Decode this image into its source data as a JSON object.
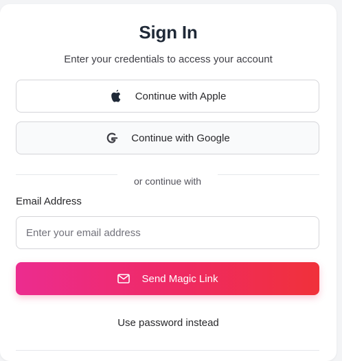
{
  "header": {
    "title": "Sign In",
    "subtitle": "Enter your credentials to access your account"
  },
  "oauth": {
    "apple_label": "Continue with Apple",
    "apple_icon": "apple-logo-icon",
    "google_label": "Continue with Google",
    "google_icon": "google-g-icon"
  },
  "divider": {
    "text": "or continue with"
  },
  "email": {
    "label": "Email Address",
    "value": "",
    "placeholder": "Enter your email address"
  },
  "magic_link": {
    "label": "Send Magic Link",
    "icon": "mail-icon",
    "gradient_start": "#ec2c8f",
    "gradient_end": "#f0313a"
  },
  "alternate": {
    "password_label": "Use password instead"
  }
}
